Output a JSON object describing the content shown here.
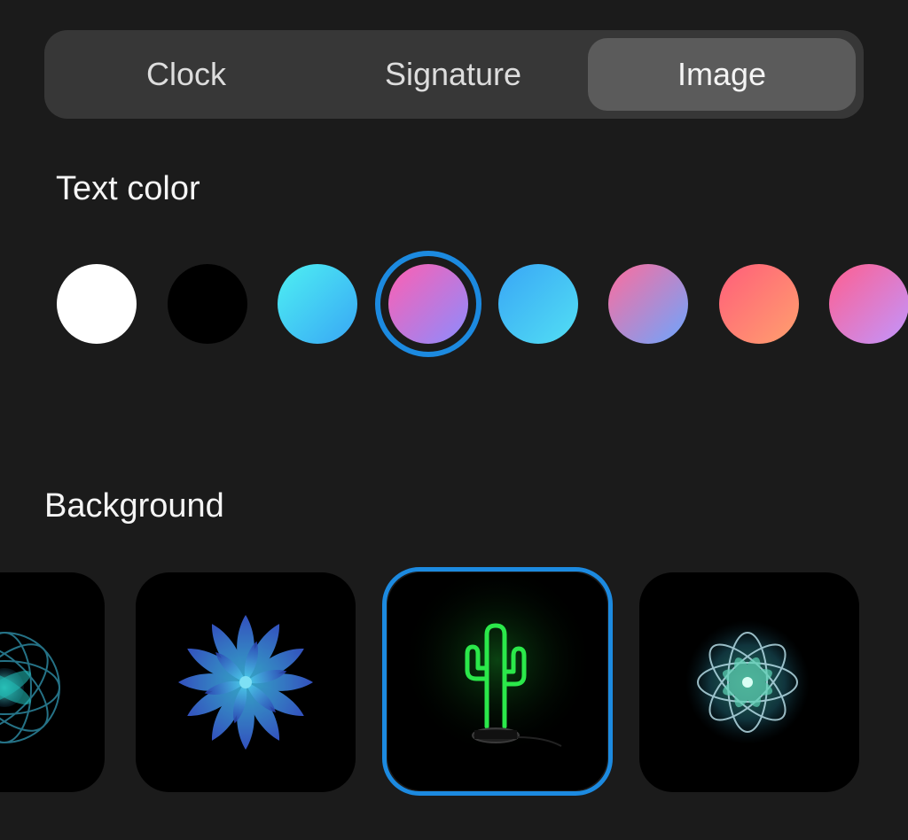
{
  "tabs": {
    "clock_label": "Clock",
    "signature_label": "Signature",
    "image_label": "Image",
    "selected": "Image"
  },
  "text_color": {
    "label": "Text color",
    "selected_index": 3,
    "swatches": [
      {
        "name": "white",
        "colors": [
          "#ffffff",
          "#ffffff"
        ]
      },
      {
        "name": "black",
        "colors": [
          "#000000",
          "#000000"
        ]
      },
      {
        "name": "cyan-blue",
        "colors": [
          "#4ef0f2",
          "#38a6f5"
        ]
      },
      {
        "name": "pink-violet",
        "colors": [
          "#ff5fb1",
          "#8b8cff"
        ]
      },
      {
        "name": "sky-blue",
        "colors": [
          "#39a6f6",
          "#52dff3"
        ]
      },
      {
        "name": "pink-blue",
        "colors": [
          "#ff6c9c",
          "#6ba6ff"
        ]
      },
      {
        "name": "coral-peach",
        "colors": [
          "#ff5e7a",
          "#ffa06e"
        ]
      },
      {
        "name": "pink-lavender",
        "colors": [
          "#ff5e8f",
          "#c196ff"
        ]
      }
    ],
    "accent": "#1c8ae0"
  },
  "background": {
    "label": "Background",
    "selected_index": 2,
    "thumbnails": [
      {
        "name": "teal-mandala-icon"
      },
      {
        "name": "blue-flower-icon"
      },
      {
        "name": "neon-cactus-icon"
      },
      {
        "name": "crystal-kaleidoscope-icon"
      }
    ]
  }
}
